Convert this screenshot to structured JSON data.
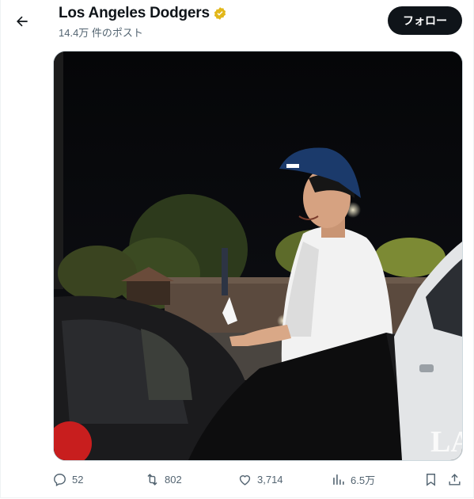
{
  "header": {
    "title": "Los Angeles Dodgers",
    "subtitle": "14.4万 件のポスト",
    "follow_label": "フォロー"
  },
  "media": {
    "icon": "video-thumbnail",
    "watermark": "LA"
  },
  "actions": {
    "replies": "52",
    "reposts": "802",
    "likes": "3,714",
    "views": "6.5万"
  },
  "colors": {
    "text": "#0f1419",
    "secondary": "#536471",
    "verified_gold": "#e2b719",
    "button_bg": "#0f1419"
  }
}
